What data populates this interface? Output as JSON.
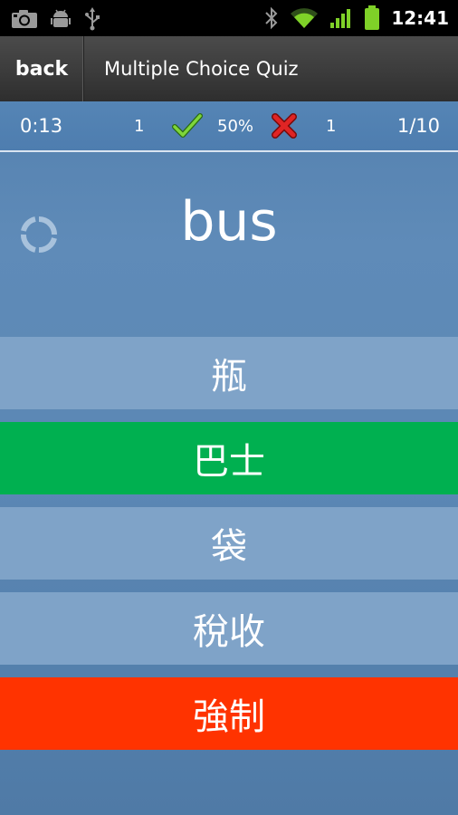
{
  "status_bar": {
    "time": "12:41",
    "left_icons": [
      "camera-icon",
      "android-debug-icon",
      "usb-icon"
    ],
    "right_icons": [
      "bluetooth-icon",
      "wifi-icon",
      "signal-icon",
      "battery-icon"
    ]
  },
  "header": {
    "back_label": "back",
    "title": "Multiple Choice Quiz"
  },
  "score": {
    "timer": "0:13",
    "correct_count": "1",
    "percent": "50%",
    "wrong_count": "1",
    "progress": "1/10"
  },
  "question": {
    "word": "bus"
  },
  "choices": [
    {
      "label": "瓶",
      "state": "neutral"
    },
    {
      "label": "巴士",
      "state": "correct"
    },
    {
      "label": "袋",
      "state": "neutral"
    },
    {
      "label": "稅收",
      "state": "neutral"
    },
    {
      "label": "強制",
      "state": "wrong"
    }
  ],
  "colors": {
    "correct": "#00b050",
    "wrong": "#ff3300",
    "neutral": "#7fa3c8",
    "background": "#5b87b4"
  }
}
